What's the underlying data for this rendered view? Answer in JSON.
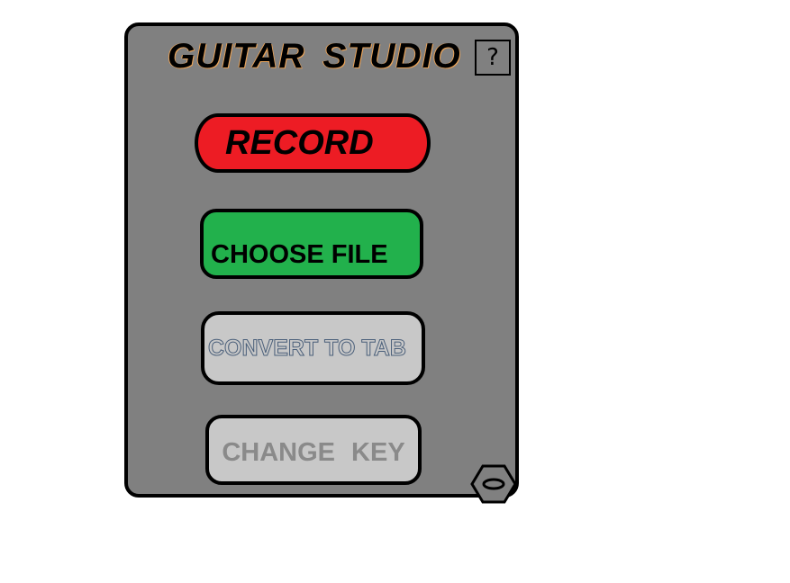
{
  "app": {
    "title": "GUITAR  STUDIO",
    "help_label": "?"
  },
  "buttons": {
    "record": {
      "label": "RECORD",
      "color": "#ed1c24"
    },
    "choose_file": {
      "label": "CHOOSE FILE",
      "color": "#22b14c"
    },
    "convert_to_tab": {
      "label": "CONVERT TO TAB",
      "color": "#c8c8c8",
      "state": "disabled"
    },
    "change_key": {
      "label": "CHANGE  KEY",
      "color": "#c8c8c8",
      "state": "disabled"
    }
  },
  "icons": {
    "settings": "hex-nut-icon"
  },
  "colors": {
    "panel_background": "#808080",
    "border": "#000000",
    "title_outline": "#e8a35a"
  }
}
